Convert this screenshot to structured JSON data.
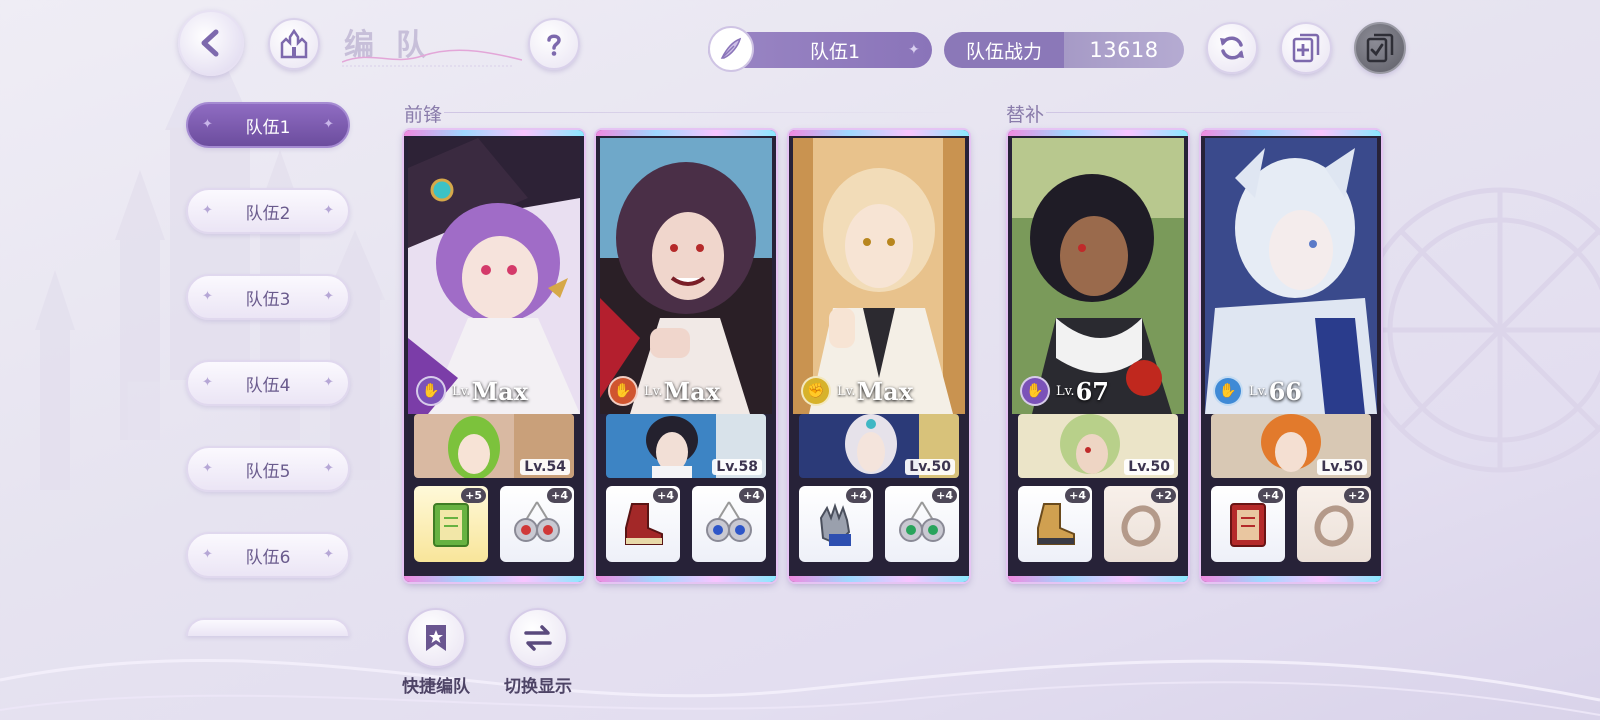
{
  "header": {
    "title": "编队",
    "team_name": "队伍1",
    "power_label": "队伍战力",
    "power_value": "13618"
  },
  "sidebar": {
    "tabs": [
      {
        "label": "队伍1",
        "active": true
      },
      {
        "label": "队伍2",
        "active": false
      },
      {
        "label": "队伍3",
        "active": false
      },
      {
        "label": "队伍4",
        "active": false
      },
      {
        "label": "队伍5",
        "active": false
      },
      {
        "label": "队伍6",
        "active": false
      }
    ]
  },
  "sections": {
    "front": "前锋",
    "backup": "替补"
  },
  "cards": [
    {
      "lv_prefix": "Lv.",
      "level": "Max",
      "element_color": "#7b52b8",
      "sub_level": "Lv.54",
      "gear": [
        {
          "plus": "+5",
          "icon": "book-icon"
        },
        {
          "plus": "+4",
          "icon": "earring-icon"
        }
      ]
    },
    {
      "lv_prefix": "Lv.",
      "level": "Max",
      "element_color": "#d0552f",
      "sub_level": "Lv.58",
      "gear": [
        {
          "plus": "+4",
          "icon": "boot-icon"
        },
        {
          "plus": "+4",
          "icon": "earring-icon"
        }
      ]
    },
    {
      "lv_prefix": "Lv.",
      "level": "Max",
      "element_color": "#d7b22a",
      "sub_level": "Lv.50",
      "gear": [
        {
          "plus": "+4",
          "icon": "glove-icon"
        },
        {
          "plus": "+4",
          "icon": "earring-icon"
        }
      ]
    },
    {
      "lv_prefix": "Lv.",
      "level": "67",
      "element_color": "#7b52b8",
      "sub_level": "Lv.50",
      "gear": [
        {
          "plus": "+4",
          "icon": "boot-icon"
        },
        {
          "plus": "+2",
          "icon": "ring-icon"
        }
      ]
    },
    {
      "lv_prefix": "Lv.",
      "level": "66",
      "element_color": "#3f8ad6",
      "sub_level": "Lv.50",
      "gear": [
        {
          "plus": "+4",
          "icon": "book-icon"
        },
        {
          "plus": "+2",
          "icon": "ring-icon"
        }
      ]
    }
  ],
  "bottom": {
    "quick_label": "快捷编队",
    "switch_label": "切换显示"
  },
  "icons": {
    "back": "back-arrow-icon",
    "home": "castle-icon",
    "help": "question-icon",
    "quill": "quill-icon",
    "refresh": "refresh-icon",
    "add_copy": "add-copy-icon",
    "check_copy": "check-copy-icon",
    "quick": "bookmark-star-icon",
    "switch": "swap-arrows-icon"
  },
  "colors": {
    "accent": "#8a74b9",
    "active_tab": "#7a58ad"
  }
}
